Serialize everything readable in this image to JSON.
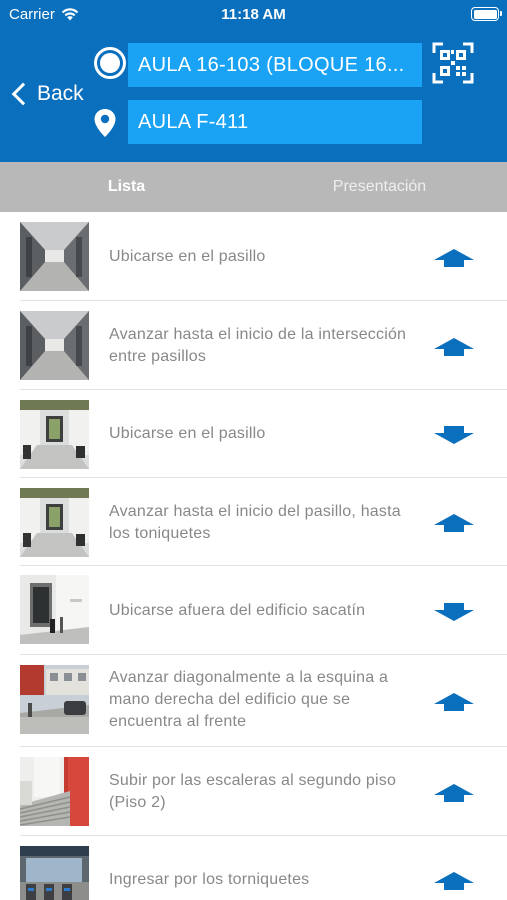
{
  "status_bar": {
    "carrier": "Carrier",
    "time": "11:18 AM"
  },
  "nav": {
    "back_label": "Back",
    "origin_value": "AULA 16-103 (BLOQUE 16...",
    "destination_value": "AULA F-411"
  },
  "tabs": [
    {
      "label": "Lista",
      "selected": true
    },
    {
      "label": "Presentación",
      "selected": false
    }
  ],
  "steps": [
    {
      "text": "Ubicarse en el pasillo",
      "direction": "up",
      "thumb": "corridor"
    },
    {
      "text": "Avanzar hasta el inicio de la intersección entre pasillos",
      "direction": "up",
      "thumb": "corridor"
    },
    {
      "text": "Ubicarse en el pasillo",
      "direction": "down",
      "thumb": "hall"
    },
    {
      "text": "Avanzar hasta el inicio del pasillo, hasta los toniquetes",
      "direction": "up",
      "thumb": "hall"
    },
    {
      "text": "Ubicarse afuera del edificio sacatín",
      "direction": "down",
      "thumb": "entrance"
    },
    {
      "text": "Avanzar diagonalmente a la esquina a mano derecha del edificio que se encuentra al frente",
      "direction": "up",
      "thumb": "street"
    },
    {
      "text": "Subir por las escaleras al segundo piso (Piso 2)",
      "direction": "up",
      "thumb": "stairs"
    },
    {
      "text": "Ingresar por los torniquetes",
      "direction": "up",
      "thumb": "turnstile"
    }
  ],
  "colors": {
    "header_bg": "#0a6fbd",
    "field_bg": "#1aa3f4",
    "tab_bar_bg": "#b8b8b8",
    "arrow": "#0a6fbd",
    "step_text": "#888888"
  },
  "icons": {
    "back": "chevron-left-icon",
    "origin": "origin-circle-icon",
    "destination": "map-pin-icon",
    "scan": "qr-code-icon",
    "direction_up": "arrow-up-icon",
    "direction_down": "arrow-down-icon"
  }
}
